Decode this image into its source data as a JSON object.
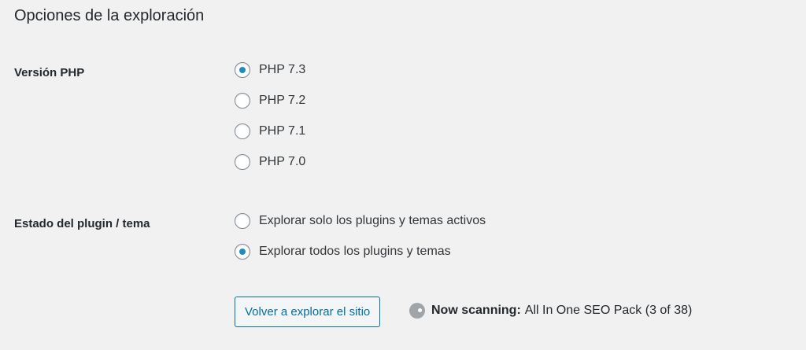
{
  "section": {
    "title": "Opciones de la exploración"
  },
  "php_version": {
    "label": "Versión PHP",
    "options": [
      {
        "label": "PHP 7.3",
        "selected": true
      },
      {
        "label": "PHP 7.2",
        "selected": false
      },
      {
        "label": "PHP 7.1",
        "selected": false
      },
      {
        "label": "PHP 7.0",
        "selected": false
      }
    ]
  },
  "plugin_status": {
    "label": "Estado del plugin / tema",
    "options": [
      {
        "label": "Explorar solo los plugins y temas activos",
        "selected": false
      },
      {
        "label": "Explorar todos los plugins y temas",
        "selected": true
      }
    ]
  },
  "actions": {
    "rescan_label": "Volver a explorar el sitio"
  },
  "scan": {
    "status_label": "Now scanning:",
    "status_text": "All In One SEO Pack (3 of 38)"
  },
  "colors": {
    "accent": "#1e8cbe",
    "button_border": "#0071a1",
    "background": "#f1f1f1"
  }
}
